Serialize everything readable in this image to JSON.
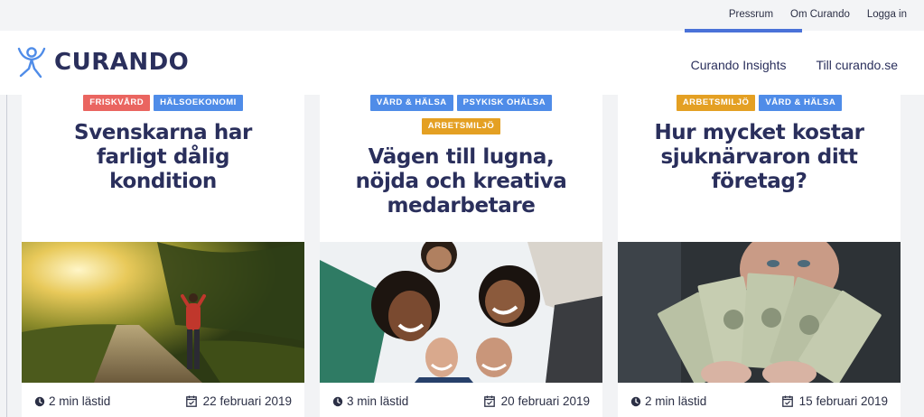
{
  "topbar": {
    "links": [
      "Pressrum",
      "Om Curando",
      "Logga in"
    ]
  },
  "header": {
    "logo_text": "CURANDO",
    "nav": [
      "Curando Insights",
      "Till curando.se"
    ]
  },
  "colors": {
    "brand_navy": "#2a2f5c",
    "tag_red": "#ea6560",
    "tag_blue": "#4f8ce8",
    "tag_orange": "#e4a023",
    "accent_blue": "#4a72d8"
  },
  "cards": [
    {
      "tags": [
        {
          "label": "FRISKVÅRD",
          "color": "red"
        },
        {
          "label": "HÄLSOEKONOMI",
          "color": "blue"
        }
      ],
      "title": "Svenskarna har farligt dålig kondition",
      "image": "woman-running-on-sunlit-road",
      "read_time": "2 min lästid",
      "date": "22 februari 2019"
    },
    {
      "tags": [
        {
          "label": "VÅRD & HÄLSA",
          "color": "blue"
        },
        {
          "label": "PSYKISK OHÄLSA",
          "color": "blue"
        },
        {
          "label": "ARBETSMILJÖ",
          "color": "orange"
        }
      ],
      "title": "Vägen till lugna, nöjda och kreativa medarbetare",
      "image": "smiling-colleagues-looking-down",
      "read_time": "3 min lästid",
      "date": "20 februari 2019"
    },
    {
      "tags": [
        {
          "label": "ARBETSMILJÖ",
          "color": "orange"
        },
        {
          "label": "VÅRD & HÄLSA",
          "color": "blue"
        }
      ],
      "title": "Hur mycket kostar sjuknärvaron ditt företag?",
      "image": "man-holding-dollar-bills",
      "read_time": "2 min lästid",
      "date": "15 februari 2019"
    }
  ]
}
